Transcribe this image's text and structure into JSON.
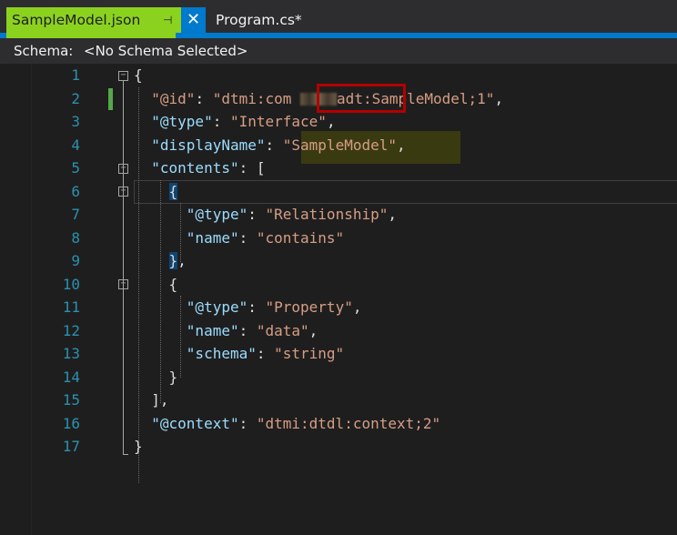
{
  "tabs": {
    "active": {
      "label": "SampleModel.json",
      "pin_glyph": "⊣",
      "close_glyph": "✕"
    },
    "inactive": {
      "label": "Program.cs*"
    }
  },
  "schema": {
    "label": "Schema:",
    "value": "<No Schema Selected>"
  },
  "line_numbers": [
    "1",
    "2",
    "3",
    "4",
    "5",
    "6",
    "7",
    "8",
    "9",
    "10",
    "11",
    "12",
    "13",
    "14",
    "15",
    "16",
    "17"
  ],
  "code": {
    "l1_open": "{",
    "l2_key": "\"@id\"",
    "l2_sep": ": ",
    "l2_val_a": "\"dtmi:com",
    "l2_val_b": "adt:",
    "l2_val_c": "SampleModel;1\"",
    "l2_end": ",",
    "l3_key": "\"@type\"",
    "l3_sep": ": ",
    "l3_val": "\"Interface\"",
    "l3_end": ",",
    "l4_key": "\"displayName\"",
    "l4_sep": ": ",
    "l4_val": "\"SampleModel\"",
    "l4_end": ",",
    "l5_key": "\"contents\"",
    "l5_sep": ": [",
    "l6_open": "{",
    "l7_key": "\"@type\"",
    "l7_sep": ": ",
    "l7_val": "\"Relationship\"",
    "l7_end": ",",
    "l8_key": "\"name\"",
    "l8_sep": ": ",
    "l8_val": "\"contains\"",
    "l9_close": "}",
    "l9_end": ",",
    "l10_open": "{",
    "l11_key": "\"@type\"",
    "l11_sep": ": ",
    "l11_val": "\"Property\"",
    "l11_end": ",",
    "l12_key": "\"name\"",
    "l12_sep": ": ",
    "l12_val": "\"data\"",
    "l12_end": ",",
    "l13_key": "\"schema\"",
    "l13_sep": ": ",
    "l13_val": "\"string\"",
    "l14_close": "}",
    "l15_close": "],",
    "l16_key": "\"@context\"",
    "l16_sep": ": ",
    "l16_val": "\"dtmi:dtdl:context;2\"",
    "l17_close": "}"
  },
  "colors": {
    "active_tab": "#8bd21f",
    "accent": "#007acc",
    "key": "#9cdcfe",
    "string": "#d69d85",
    "line_number": "#2b91af",
    "annotation_box": "#b30000"
  }
}
